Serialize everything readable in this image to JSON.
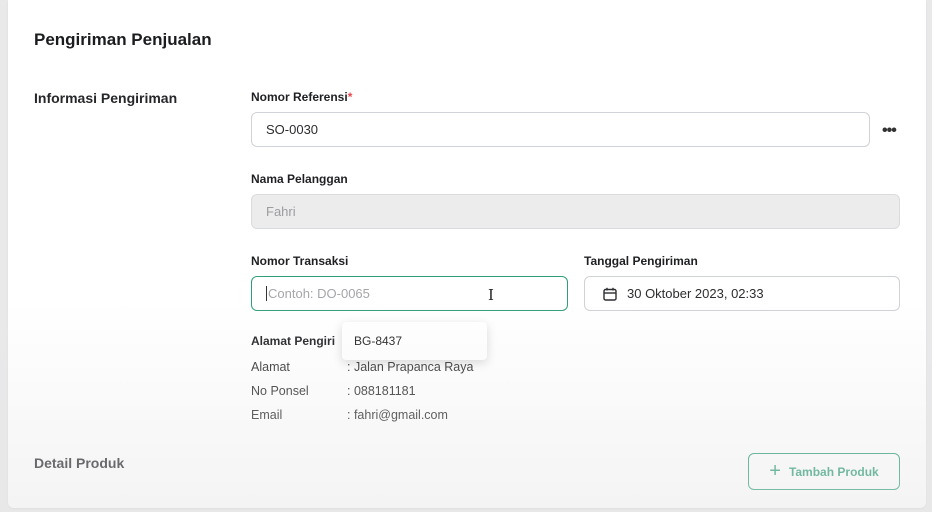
{
  "page": {
    "title": "Pengiriman Penjualan"
  },
  "sections": {
    "shipping_info": "Informasi Pengiriman",
    "product_detail": "Detail Produk"
  },
  "fields": {
    "reference": {
      "label": "Nomor Referensi",
      "required_mark": "*",
      "value": "SO-0030"
    },
    "customer": {
      "label": "Nama Pelanggan",
      "value": "Fahri"
    },
    "transaction": {
      "label": "Nomor Transaksi",
      "placeholder": "Contoh: DO-0065"
    },
    "ship_date": {
      "label": "Tanggal Pengiriman",
      "value": "30 Oktober 2023, 02:33",
      "icon": "calendar-icon"
    }
  },
  "more_menu": {
    "icon": "more-horizontal-icon",
    "label": "•••"
  },
  "suggestion": {
    "item": "BG-8437"
  },
  "address": {
    "title": "Alamat Pengiri",
    "rows": [
      {
        "key": "Alamat",
        "value": ": Jalan Prapanca Raya"
      },
      {
        "key": "No Ponsel",
        "value": ": 088181181"
      },
      {
        "key": "Email",
        "value": ": fahri@gmail.com"
      }
    ]
  },
  "add_product": {
    "icon": "plus-icon",
    "label": "Tambah Produk"
  },
  "colors": {
    "accent": "#2f9e78",
    "required": "#e5484d",
    "disabled_bg": "#ececed"
  }
}
